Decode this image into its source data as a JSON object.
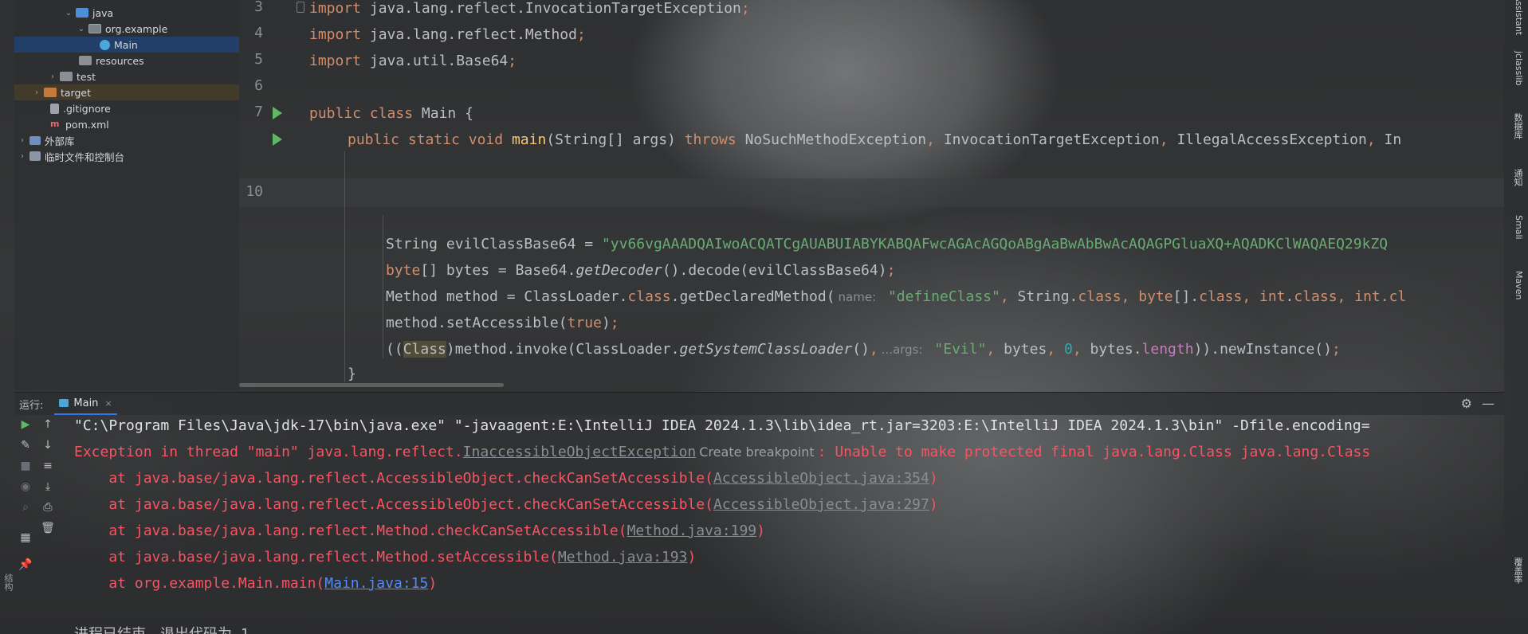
{
  "project_tree": {
    "items": [
      {
        "label": "java",
        "icon": "folder-blue-icon",
        "chevron": "down"
      },
      {
        "label": "org.example",
        "icon": "package-icon",
        "chevron": "down"
      },
      {
        "label": "Main",
        "icon": "java-class-icon",
        "chevron": ""
      },
      {
        "label": "resources",
        "icon": "folder-icon",
        "chevron": ""
      },
      {
        "label": "test",
        "icon": "folder-icon",
        "chevron": "right"
      },
      {
        "label": "target",
        "icon": "folder-orange-icon",
        "chevron": "right"
      },
      {
        "label": ".gitignore",
        "icon": "file-icon",
        "chevron": ""
      },
      {
        "label": "pom.xml",
        "icon": "maven-icon",
        "chevron": ""
      },
      {
        "label": "外部库",
        "icon": "library-icon",
        "chevron": "right"
      },
      {
        "label": "临时文件和控制台",
        "icon": "scratch-icon",
        "chevron": "right"
      }
    ]
  },
  "editor": {
    "line_numbers": [
      "3",
      "4",
      "5",
      "6",
      "7",
      "10"
    ],
    "code": {
      "l3": {
        "kw": "import",
        "rest": " java.lang.reflect.InvocationTargetException",
        "semi": ";"
      },
      "l4": {
        "kw": "import",
        "rest": " java.lang.reflect.Method",
        "semi": ";"
      },
      "l5": {
        "kw": "import",
        "rest": " java.util.Base64",
        "semi": ";"
      },
      "l7": {
        "kw1": "public",
        "kw2": "class",
        "rest": " Main {"
      },
      "l8": {
        "kw1": "public",
        "kw2": "static",
        "kw3": "void",
        "fn": "main",
        "params": "(String[] args) ",
        "throws": "throws",
        "exc1": " NoSuchMethodException",
        "c1": ",",
        "exc2": " InvocationTargetException",
        "c2": ",",
        "exc3": " IllegalAccessException",
        "c3": ",",
        "exc4": " In"
      },
      "l12": {
        "type": "String evilClassBase64 = ",
        "str": "\"yv66vgAAADQAIwoACQATCgAUABUIABYKABQAFwcAGAcAGQoABgAaBwAbBwAcAQAGPGluaXQ+AQADKClWAQAEQ29kZQ"
      },
      "l13": {
        "kw": "byte",
        "a": "[] bytes = Base64.",
        "it": "getDecoder",
        "b": "().decode(evilClassBase64)",
        "semi": ";"
      },
      "l14": {
        "a": "Method method = ClassLoader.",
        "kw": "class",
        "b": ".getDeclaredMethod(",
        "hint": "name:",
        "str": " \"defineClass\"",
        "c1": ",",
        "d": " String.",
        "kw2": "class",
        "c2": ",",
        "kw3": " byte",
        "e": "[].",
        "kw4": "class",
        "c3": ",",
        "kw5": " int",
        "f": ".",
        "kw6": "class",
        "c4": ",",
        "kw7": " int",
        "g": ".cl"
      },
      "l15": {
        "a": "method.setAccessible(",
        "kw": "true",
        "b": ")",
        "semi": ";"
      },
      "l16": {
        "a": "((",
        "cls": "Class",
        "b": ")method.invoke(ClassLoader.",
        "it": "getSystemClassLoader",
        "c": "()",
        "c1": ",",
        "hint": "...args:",
        "str": " \"Evil\"",
        "c2": ",",
        "d": " bytes",
        "c3": ",",
        "num": " 0",
        "c4": ",",
        "e": " bytes.",
        "len": "length",
        "f": ")).newInstance()",
        "semi": ";"
      },
      "l17": {
        "a": "}"
      }
    }
  },
  "run_panel": {
    "label": "运行:",
    "tab": "Main",
    "tab_close": "×",
    "console": {
      "cmd": "\"C:\\Program Files\\Java\\jdk-17\\bin\\java.exe\" \"-javaagent:E:\\IntelliJ IDEA 2024.1.3\\lib\\idea_rt.jar=3203:E:\\IntelliJ IDEA 2024.1.3\\bin\" -Dfile.encoding=",
      "exc_prefix": "Exception in thread \"main\" java.lang.reflect.",
      "exc_class": "InaccessibleObjectException",
      "bp_hint": "Create breakpoint",
      "exc_msg": ": Unable to make protected final java.lang.Class java.lang.Class",
      "stack": [
        {
          "at": "    at java.base/java.lang.reflect.AccessibleObject.checkCanSetAccessible(",
          "link": "AccessibleObject.java:354",
          "end": ")"
        },
        {
          "at": "    at java.base/java.lang.reflect.AccessibleObject.checkCanSetAccessible(",
          "link": "AccessibleObject.java:297",
          "end": ")"
        },
        {
          "at": "    at java.base/java.lang.reflect.Method.checkCanSetAccessible(",
          "link": "Method.java:199",
          "end": ")"
        },
        {
          "at": "    at java.base/java.lang.reflect.Method.setAccessible(",
          "link": "Method.java:193",
          "end": ")"
        },
        {
          "at": "    at org.example.Main.main(",
          "link": "Main.java:15",
          "end": ")"
        }
      ],
      "exit": "进程已结束，退出代码为 1"
    }
  },
  "left_strip": {
    "bottom_label": "结构"
  },
  "right_strip": {
    "items": [
      "Assistant",
      "jclasslib",
      "数据库",
      "通知",
      "Smali",
      "Maven",
      "覆盖率"
    ]
  }
}
